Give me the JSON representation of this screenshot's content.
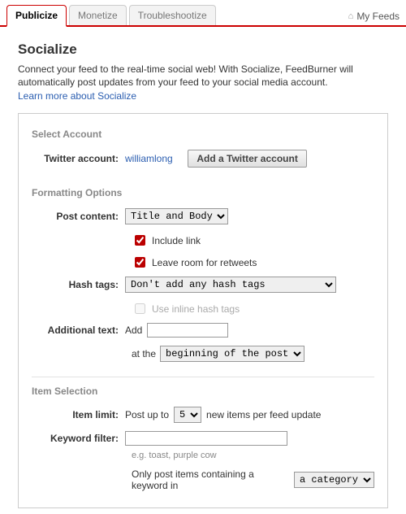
{
  "tabs": {
    "publicize": "Publicize",
    "monetize": "Monetize",
    "troubleshoot": "Troubleshootize"
  },
  "my_feeds": "My Feeds",
  "page": {
    "title": "Socialize",
    "intro": "Connect your feed to the real-time social web! With Socialize, FeedBurner will automatically post updates from your feed to your social media account.",
    "learn_more": "Learn more about Socialize"
  },
  "account": {
    "section": "Select Account",
    "label": "Twitter account:",
    "username": "williamlong",
    "add_button": "Add a Twitter account"
  },
  "formatting": {
    "section": "Formatting Options",
    "post_content_label": "Post content:",
    "post_content_value": "Title and Body",
    "include_link": "Include link",
    "leave_room": "Leave room for retweets",
    "hash_tags_label": "Hash tags:",
    "hash_tags_value": "Don't add any hash tags",
    "inline_hash": "Use inline hash tags",
    "additional_text_label": "Additional text:",
    "add_word": "Add",
    "additional_text_value": "",
    "at_the": "at the",
    "position_value": "beginning of the post"
  },
  "item_selection": {
    "section": "Item Selection",
    "item_limit_label": "Item limit:",
    "post_up_to": "Post up to",
    "limit_value": "5",
    "new_items_tail": "new items per feed update",
    "keyword_filter_label": "Keyword filter:",
    "keyword_filter_value": "",
    "keyword_hint": "e.g. toast, purple cow",
    "only_post": "Only post items containing a keyword in",
    "scope_value": "a category"
  }
}
